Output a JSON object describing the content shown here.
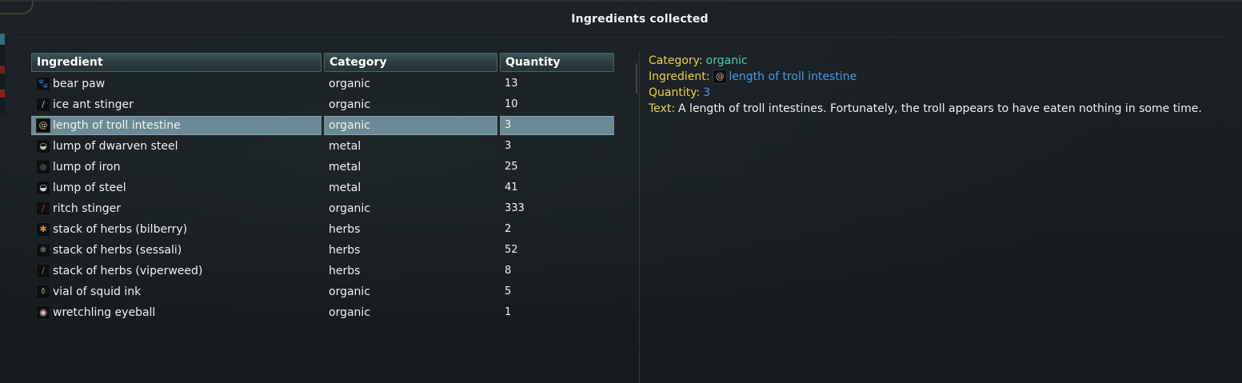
{
  "window": {
    "title": "Ingredients collected"
  },
  "table": {
    "headers": {
      "ingredient": "Ingredient",
      "category": "Category",
      "quantity": "Quantity"
    },
    "rows": [
      {
        "icon": "bear-paw-icon",
        "glyph": "🐾",
        "color": "#8a6a4a",
        "name": "bear paw",
        "category": "organic",
        "quantity": "13"
      },
      {
        "icon": "ice-ant-stinger-icon",
        "glyph": "/",
        "color": "#9fc4e0",
        "name": "ice ant stinger",
        "category": "organic",
        "quantity": "10"
      },
      {
        "icon": "troll-intestine-icon",
        "glyph": "@",
        "color": "#d8b0a0",
        "name": "length of troll intestine",
        "category": "organic",
        "quantity": "3"
      },
      {
        "icon": "dwarven-steel-icon",
        "glyph": "◒",
        "color": "#a8c8a0",
        "name": "lump of dwarven steel",
        "category": "metal",
        "quantity": "3"
      },
      {
        "icon": "iron-lump-icon",
        "glyph": "●",
        "color": "#3a3a3a",
        "name": "lump of iron",
        "category": "metal",
        "quantity": "25"
      },
      {
        "icon": "steel-lump-icon",
        "glyph": "◒",
        "color": "#c8d4dc",
        "name": "lump of steel",
        "category": "metal",
        "quantity": "41"
      },
      {
        "icon": "ritch-stinger-icon",
        "glyph": "/",
        "color": "#c04030",
        "name": "ritch stinger",
        "category": "organic",
        "quantity": "333"
      },
      {
        "icon": "bilberry-herb-icon",
        "glyph": "✱",
        "color": "#c89040",
        "name": "stack of herbs (bilberry)",
        "category": "herbs",
        "quantity": "2"
      },
      {
        "icon": "sessali-herb-icon",
        "glyph": "✱",
        "color": "#606060",
        "name": "stack of herbs (sessali)",
        "category": "herbs",
        "quantity": "52"
      },
      {
        "icon": "viperweed-herb-icon",
        "glyph": "/",
        "color": "#8a7a40",
        "name": "stack of herbs (viperweed)",
        "category": "herbs",
        "quantity": "8"
      },
      {
        "icon": "squid-ink-vial-icon",
        "glyph": "⚱",
        "color": "#90a070",
        "name": "vial of squid ink",
        "category": "organic",
        "quantity": "5"
      },
      {
        "icon": "eyeball-icon",
        "glyph": "◉",
        "color": "#e0c0c0",
        "name": "wretchling eyeball",
        "category": "organic",
        "quantity": "1"
      }
    ],
    "selected_index": 2
  },
  "details": {
    "category_label": "Category:",
    "category_value": "organic",
    "ingredient_label": "Ingredient:",
    "ingredient_icon": "troll-intestine-icon",
    "ingredient_glyph": "@",
    "ingredient_value": "length of troll intestine",
    "quantity_label": "Quantity:",
    "quantity_value": "3",
    "text_label": "Text:",
    "text_value": "A length of troll intestines. Fortunately, the troll appears to have eaten nothing in some time."
  },
  "colors": {
    "label_gold": "#f4d03f",
    "value_teal": "#3fd3b8",
    "value_blue": "#3f9cf0",
    "selection": "#6c8a96"
  }
}
